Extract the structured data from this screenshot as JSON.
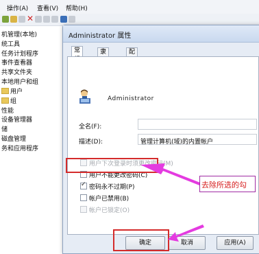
{
  "console": {
    "menus": [
      "操作(A)",
      "查看(V)",
      "帮助(H)"
    ],
    "tree_items": [
      "机管理(本地)",
      "统工具",
      "任务计划程序",
      "事件查看器",
      "共享文件夹",
      "本地用户和组",
      "用户",
      "组",
      "性能",
      "设备管理器",
      "储",
      "磁盘管理",
      "务和应用程序"
    ]
  },
  "dialog": {
    "title": "Administrator 属性",
    "tabs": [
      "常规",
      "隶属于",
      "配置文件"
    ],
    "username": "Administrator",
    "fullname_label": "全名(F):",
    "fullname_value": "",
    "description_label": "描述(D):",
    "description_value": "管理计算机(域)的内置帐户",
    "checkboxes": [
      {
        "label": "用户下次登录时须更改密码(M)",
        "checked": false,
        "disabled": true
      },
      {
        "label": "用户不能更改密码(C)",
        "checked": false,
        "disabled": false
      },
      {
        "label": "密码永不过期(P)",
        "checked": true,
        "disabled": false
      },
      {
        "label": "帐户已禁用(B)",
        "checked": false,
        "disabled": false
      },
      {
        "label": "帐户已锁定(O)",
        "checked": false,
        "disabled": true
      }
    ],
    "buttons": {
      "ok": "确定",
      "cancel": "取消",
      "apply": "应用(A)"
    }
  },
  "annotation": {
    "callout_text": "去除所选的勾",
    "color": "#d42b2b",
    "arrow_color": "#e43be0"
  }
}
